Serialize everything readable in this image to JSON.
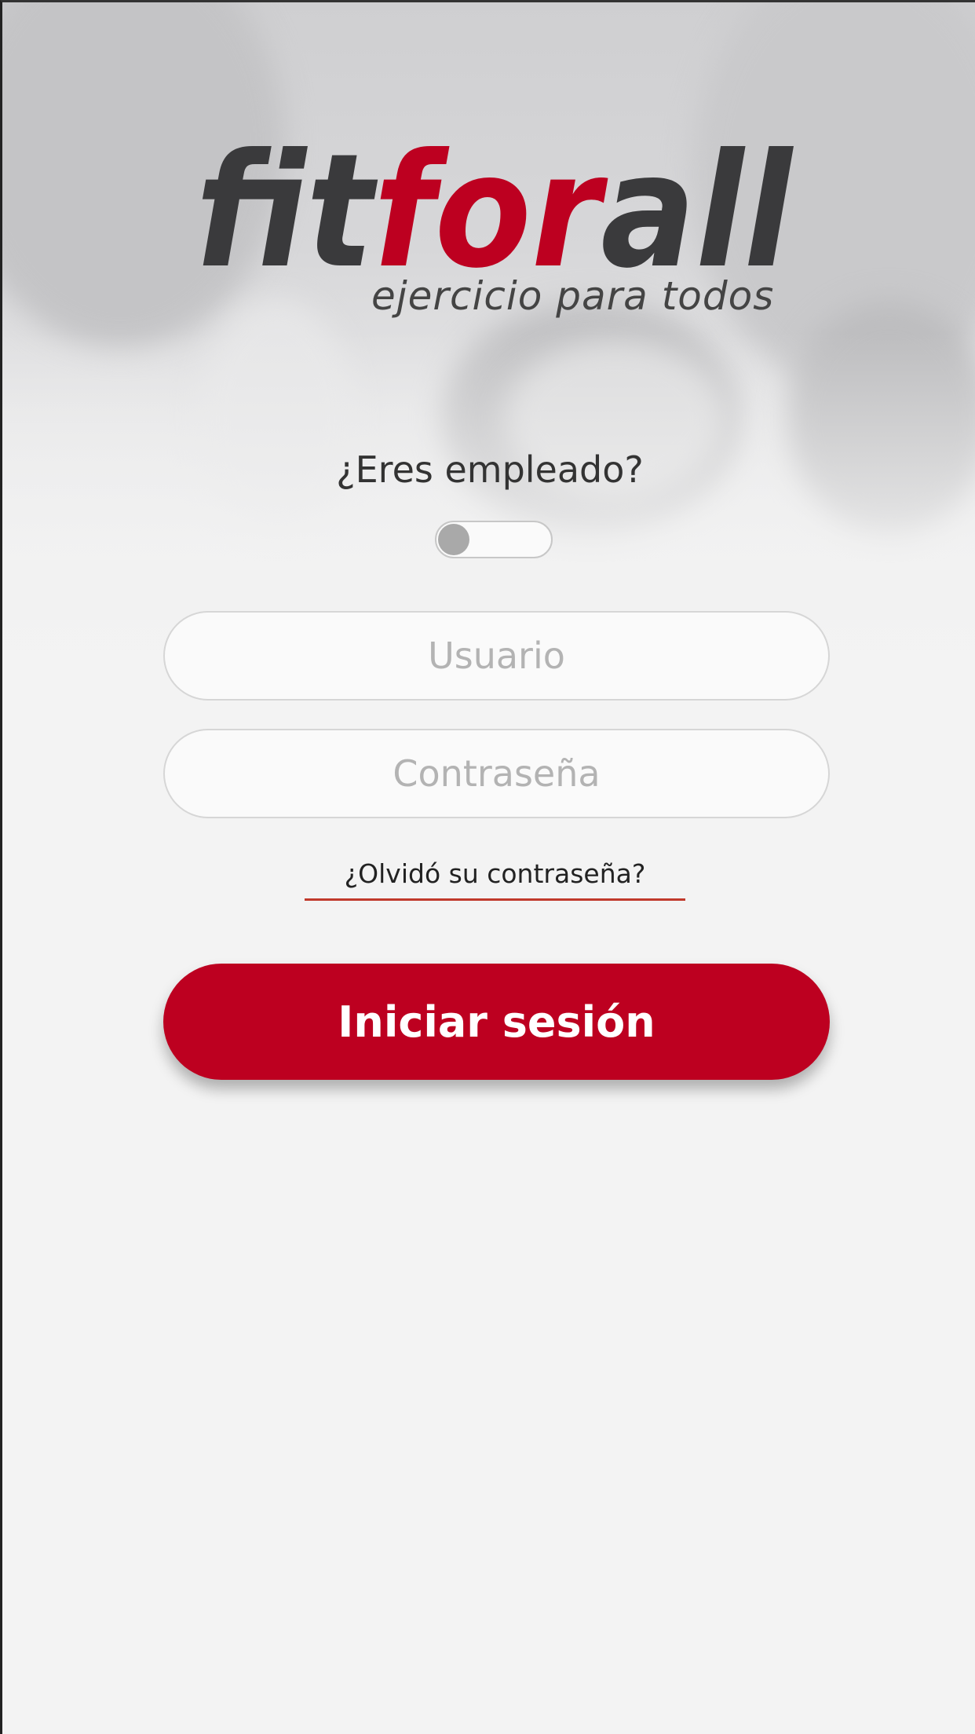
{
  "brand": {
    "name_part1": "fit",
    "name_part2": "for",
    "name_part3": "all",
    "tagline": "ejercicio para todos",
    "colors": {
      "dark": "#3a3a3c",
      "red": "#bd0020"
    }
  },
  "employee_toggle": {
    "question": "¿Eres empleado?",
    "state": "off"
  },
  "login_form": {
    "username_placeholder": "Usuario",
    "password_placeholder": "Contraseña",
    "forgot_password": "¿Olvidó su contraseña?",
    "submit_label": "Iniciar sesión"
  },
  "colors": {
    "accent": "#bd0020",
    "background": "#f3f3f3",
    "field_border": "#d6d6d6",
    "placeholder": "#b3b3b3"
  }
}
